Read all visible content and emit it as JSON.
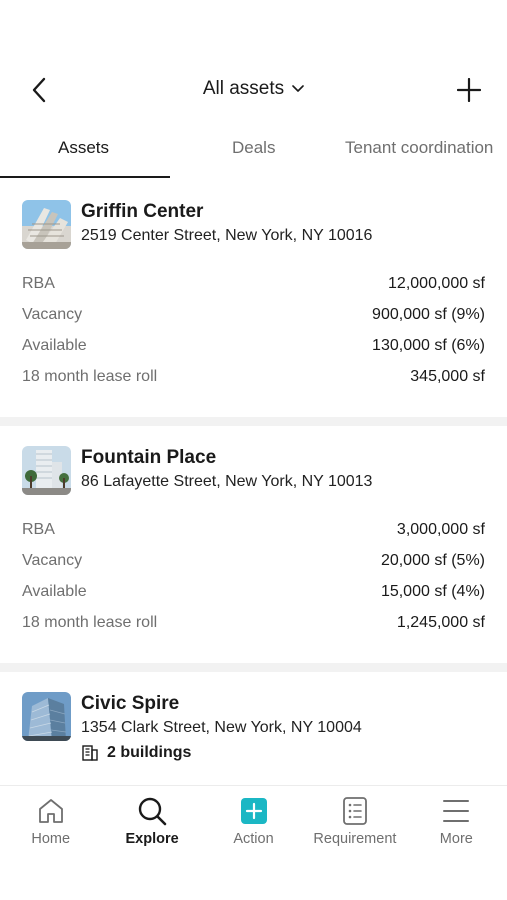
{
  "header": {
    "title": "All assets",
    "back_icon": "chevron-left-icon",
    "add_icon": "plus-icon",
    "dropdown_icon": "chevron-down-icon"
  },
  "tabs": [
    {
      "label": "Assets",
      "active": true
    },
    {
      "label": "Deals",
      "active": false
    },
    {
      "label": "Tenant coordination",
      "active": false
    }
  ],
  "assets": [
    {
      "name": "Griffin Center",
      "address": "2519 Center Street, New York, NY 10016",
      "stats": [
        {
          "label": "RBA",
          "value": "12,000,000 sf"
        },
        {
          "label": "Vacancy",
          "value": "900,000 sf (9%)"
        },
        {
          "label": "Available",
          "value": "130,000 sf (6%)"
        },
        {
          "label": "18 month lease roll",
          "value": "345,000 sf"
        }
      ]
    },
    {
      "name": "Fountain Place",
      "address": "86 Lafayette Street, New York, NY 10013",
      "stats": [
        {
          "label": "RBA",
          "value": "3,000,000 sf"
        },
        {
          "label": "Vacancy",
          "value": "20,000 sf (5%)"
        },
        {
          "label": "Available",
          "value": "15,000 sf (4%)"
        },
        {
          "label": "18 month lease roll",
          "value": "1,245,000 sf"
        }
      ]
    },
    {
      "name": "Civic Spire",
      "address": "1354 Clark Street, New York, NY 10004",
      "buildings": "2 buildings"
    }
  ],
  "bottom_nav": [
    {
      "label": "Home",
      "icon": "home-icon",
      "active": false
    },
    {
      "label": "Explore",
      "icon": "search-icon",
      "active": true
    },
    {
      "label": "Action",
      "icon": "action-plus-icon",
      "active": false
    },
    {
      "label": "Requirement",
      "icon": "requirement-list-icon",
      "active": false
    },
    {
      "label": "More",
      "icon": "menu-icon",
      "active": false
    }
  ],
  "colors": {
    "accent": "#1bb7c4",
    "text": "#1a1a1a",
    "muted": "#6f6f6f",
    "divider": "#f2f2f2"
  }
}
